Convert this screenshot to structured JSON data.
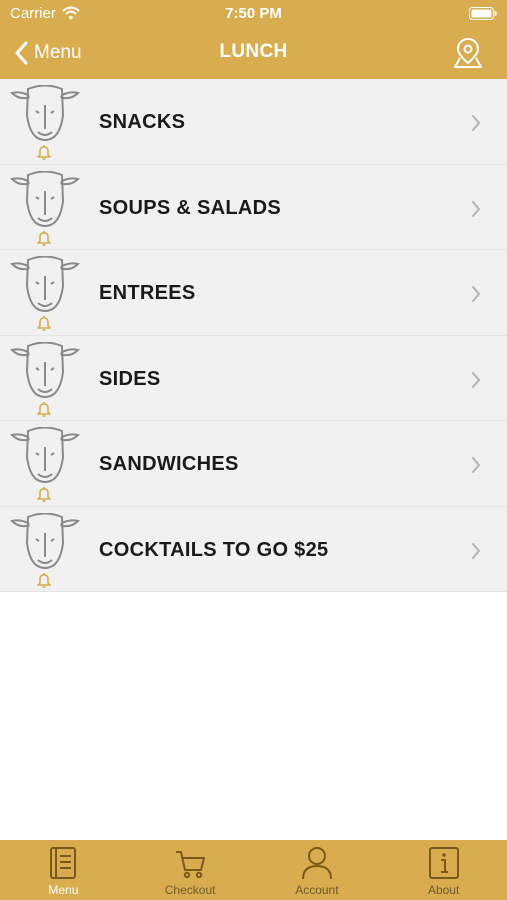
{
  "status_bar": {
    "carrier": "Carrier",
    "time": "7:50 PM"
  },
  "nav": {
    "back_label": "Menu",
    "title": "LUNCH"
  },
  "categories": [
    {
      "label": "SNACKS"
    },
    {
      "label": "SOUPS & SALADS"
    },
    {
      "label": "ENTREES"
    },
    {
      "label": "SIDES"
    },
    {
      "label": "SANDWICHES"
    },
    {
      "label": "COCKTAILS TO GO $25"
    }
  ],
  "tabs": [
    {
      "label": "Menu",
      "icon": "menu-book-icon",
      "active": true
    },
    {
      "label": "Checkout",
      "icon": "cart-icon",
      "active": false
    },
    {
      "label": "Account",
      "icon": "person-icon",
      "active": false
    },
    {
      "label": "About",
      "icon": "info-icon",
      "active": false
    }
  ],
  "colors": {
    "brand": "#d8ac4f",
    "row_bg": "#f1f1f1",
    "bell": "#d8ac4f"
  }
}
